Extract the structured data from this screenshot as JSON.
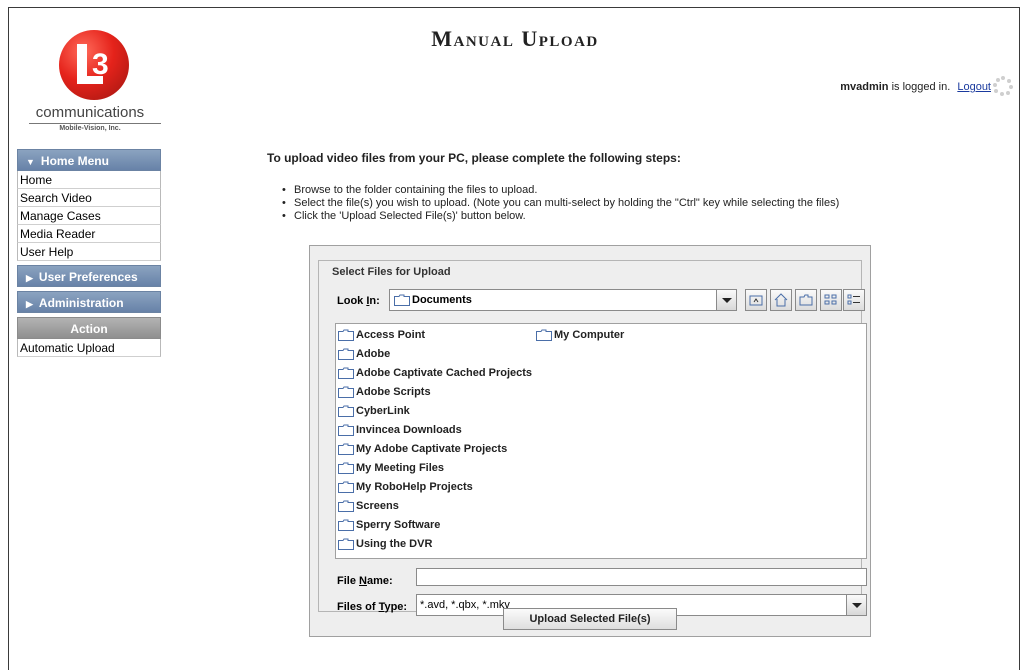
{
  "header": {
    "title": "Manual Upload",
    "logo_word": "communications",
    "logo_sub": "Mobile-Vision, Inc.",
    "login_user": "mvadmin",
    "login_text": " is logged in.",
    "logout_label": "Logout"
  },
  "sidebar": {
    "home_menu_label": "Home Menu",
    "home_items": [
      {
        "label": "Home"
      },
      {
        "label": "Search Video"
      },
      {
        "label": "Manage Cases"
      },
      {
        "label": "Media Reader"
      },
      {
        "label": "User Help"
      }
    ],
    "user_prefs_label": "User Preferences",
    "admin_label": "Administration",
    "action_label": "Action",
    "action_items": [
      {
        "label": "Automatic Upload"
      }
    ]
  },
  "main": {
    "intro": "To upload video files from your PC, please complete the following steps:",
    "steps": [
      "Browse to the folder containing the files to upload.",
      "Select the file(s) you wish to upload. (Note you can multi-select by holding the \"Ctrl\" key while selecting the files)",
      "Click the 'Upload Selected File(s)' button below."
    ]
  },
  "chooser": {
    "group_title": "Select Files for Upload",
    "look_in_label": "Look In:",
    "look_in_value": "Documents",
    "files": [
      {
        "name": "Access Point"
      },
      {
        "name": "Adobe"
      },
      {
        "name": "Adobe Captivate Cached Projects"
      },
      {
        "name": "Adobe Scripts"
      },
      {
        "name": "CyberLink"
      },
      {
        "name": "Invincea Downloads"
      },
      {
        "name": "My Adobe Captivate Projects"
      },
      {
        "name": "My Meeting Files"
      },
      {
        "name": "My RoboHelp Projects"
      },
      {
        "name": "Screens"
      },
      {
        "name": "Sperry Software"
      },
      {
        "name": "Using the DVR"
      },
      {
        "name": "My Computer"
      }
    ],
    "file_name_label": "File Name:",
    "file_name_value": "",
    "files_of_type_label": "Files of Type:",
    "files_of_type_value": "*.avd, *.qbx, *.mkv",
    "upload_button_label": "Upload Selected File(s)"
  }
}
